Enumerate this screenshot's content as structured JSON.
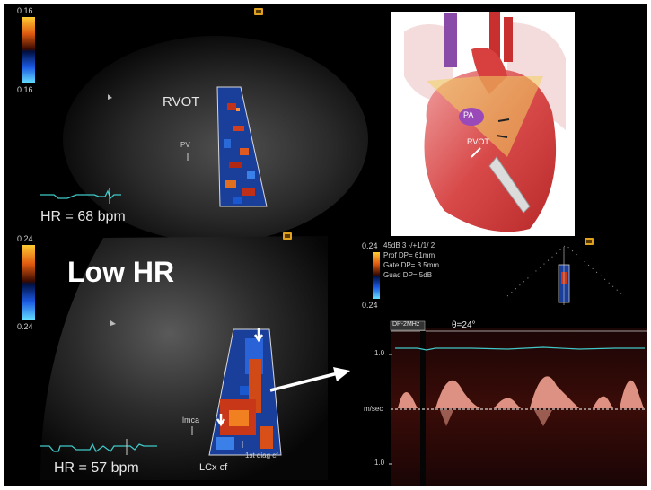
{
  "top_panel": {
    "scale_max": "0.16",
    "scale_min": "0.16",
    "label_rvot": "RVOT",
    "label_pv": "PV",
    "heart_rate": "HR = 68 bpm"
  },
  "bottom_panel": {
    "scale_max": "0.24",
    "scale_min": "0.24",
    "title": "Low HR",
    "label_lmca": "lmca",
    "label_lcx": "LCx cf",
    "label_diag": "1st diag cf",
    "heart_rate": "HR = 57 bpm"
  },
  "illustration": {
    "label_pa": "PA",
    "label_rvot": "RVOT"
  },
  "doppler_settings": {
    "scale_max": "0.24",
    "scale_min": "0.24",
    "line1": "45dB  3 -/+1/1/ 2",
    "line2": "Prof DP=  61mm",
    "line3": "Gate DP=  3.5mm",
    "line4": "Guad DP=   5dB"
  },
  "spectral": {
    "probe_tag": "DP-2MHz",
    "angle": "θ=24°",
    "tick_top": "1.0",
    "axis_unit": "m/sec",
    "tick_bottom": "1.0"
  },
  "colors": {
    "background": "#000000",
    "ecg_trace": "#40c8c8",
    "arrow": "#ffffff",
    "doppler_red": "#d03018",
    "doppler_blue": "#1a4fd0",
    "heart_red": "#d84a4a"
  }
}
